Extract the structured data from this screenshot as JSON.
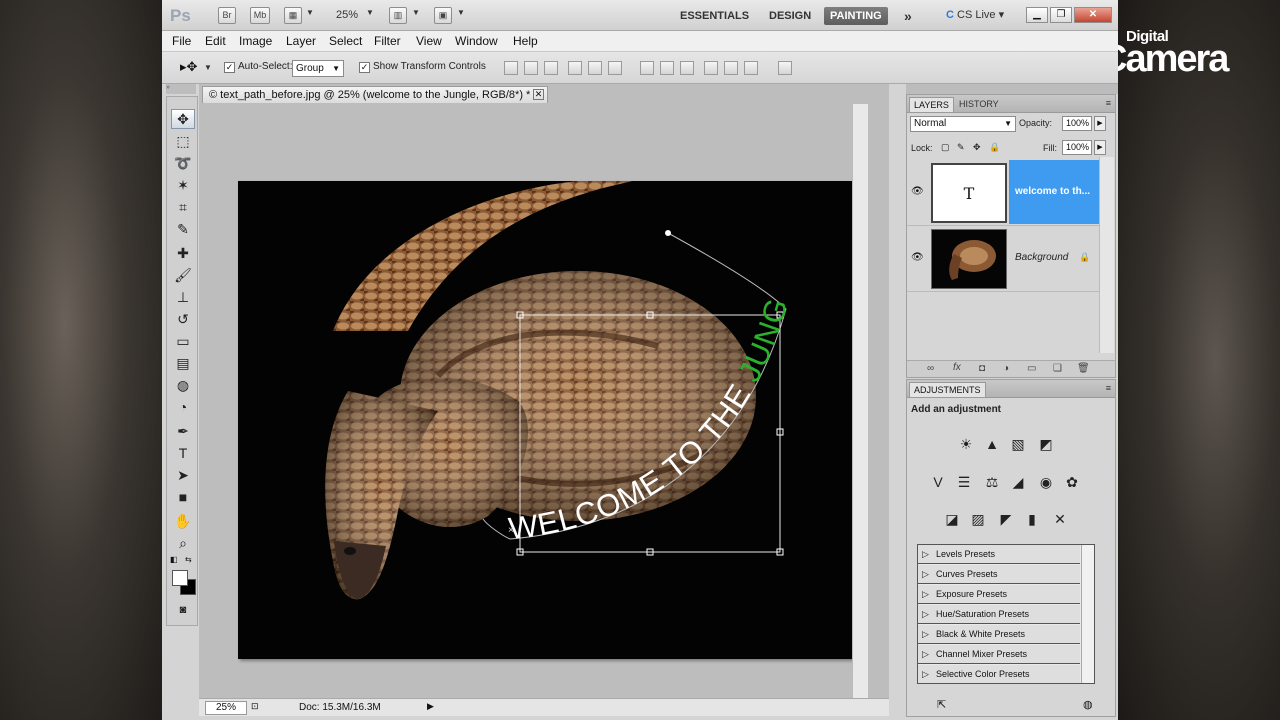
{
  "brand": {
    "line1": "Digital",
    "line2": "Camera"
  },
  "appbar": {
    "logo": "Ps",
    "bridge": "Br",
    "minibridge": "Mb",
    "zoom": "25%",
    "workspaces": [
      "ESSENTIALS",
      "DESIGN",
      "PAINTING"
    ],
    "active_workspace": "PAINTING",
    "more": "»",
    "cs_live": "CS Live"
  },
  "menu": [
    "File",
    "Edit",
    "Image",
    "Layer",
    "Select",
    "Filter",
    "View",
    "Window",
    "Help"
  ],
  "options": {
    "auto_select_label": "Auto-Select:",
    "auto_select_checked": true,
    "group_value": "Group",
    "show_transform_label": "Show Transform Controls",
    "show_transform_checked": true
  },
  "document": {
    "tab_title": "© text_path_before.jpg @ 25% (welcome to the Jungle, RGB/8*) *",
    "path_text_white": "WELCOME TO THE ",
    "path_text_green": "JUNGLE",
    "text_green": "#2ab32a"
  },
  "status": {
    "zoom": "25%",
    "doc": "Doc: 15.3M/16.3M"
  },
  "layers": {
    "tabs": [
      "LAYERS",
      "HISTORY"
    ],
    "blend_mode": "Normal",
    "opacity_label": "Opacity:",
    "opacity": "100%",
    "lock_label": "Lock:",
    "fill_label": "Fill:",
    "fill": "100%",
    "items": [
      {
        "name": "welcome to th...",
        "thumb": "T",
        "active": true
      },
      {
        "name": "Background",
        "active": false
      }
    ]
  },
  "adjustments": {
    "tab": "ADJUSTMENTS",
    "title": "Add an adjustment",
    "presets": [
      "Levels Presets",
      "Curves Presets",
      "Exposure Presets",
      "Hue/Saturation Presets",
      "Black & White Presets",
      "Channel Mixer Presets",
      "Selective Color Presets"
    ]
  },
  "colors": {
    "accent": "#3e9bf0",
    "close": "#c5452f"
  }
}
